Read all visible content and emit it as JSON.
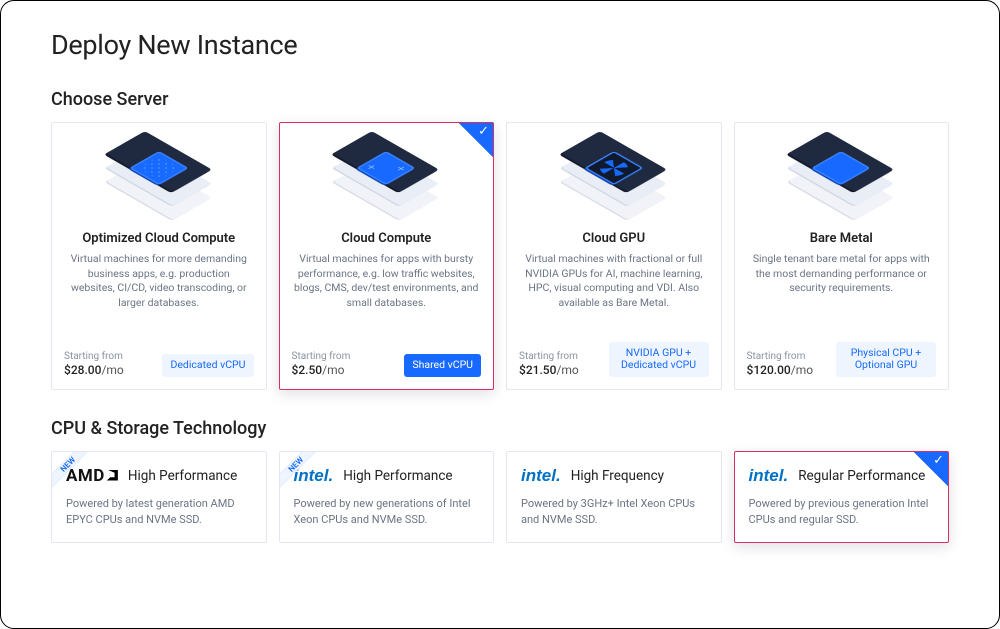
{
  "page": {
    "title": "Deploy New Instance"
  },
  "server_section": {
    "title": "Choose Server",
    "starting_label": "Starting from",
    "cards": [
      {
        "title": "Optimized Cloud Compute",
        "desc": "Virtual machines for more demanding business apps, e.g. production websites, CI/CD, video transcoding, or larger databases.",
        "price": "$28.00",
        "tag": "Dedicated vCPU",
        "tag_style": "light"
      },
      {
        "title": "Cloud Compute",
        "desc": "Virtual machines for apps with bursty performance, e.g. low traffic websites, blogs, CMS, dev/test environments, and small databases.",
        "price": "$2.50",
        "tag": "Shared vCPU",
        "tag_style": "solid",
        "selected": true
      },
      {
        "title": "Cloud GPU",
        "desc": "Virtual machines with fractional or full NVIDIA GPUs for AI, machine learning, HPC, visual computing and VDI. Also available as Bare Metal.",
        "price": "$21.50",
        "tag": "NVIDIA GPU + Dedicated vCPU",
        "tag_style": "light"
      },
      {
        "title": "Bare Metal",
        "desc": "Single tenant bare metal for apps with the most demanding performance or security requirements.",
        "price": "$120.00",
        "tag": "Physical CPU + Optional GPU",
        "tag_style": "light"
      }
    ]
  },
  "tech_section": {
    "title": "CPU & Storage Technology",
    "new_label": "NEW",
    "cards": [
      {
        "brand": "amd",
        "brand_text": "AMD",
        "title": "High Performance",
        "desc": "Powered by latest generation AMD EPYC CPUs and NVMe SSD.",
        "new": true
      },
      {
        "brand": "intel",
        "brand_text": "intel",
        "title": "High Performance",
        "desc": "Powered by new generations of Intel Xeon CPUs and NVMe SSD.",
        "new": true
      },
      {
        "brand": "intel",
        "brand_text": "intel",
        "title": "High Frequency",
        "desc": "Powered by 3GHz+ Intel Xeon CPUs and NVMe SSD."
      },
      {
        "brand": "intel",
        "brand_text": "intel",
        "title": "Regular Performance",
        "desc": "Powered by previous generation Intel CPUs and regular SSD.",
        "selected": true
      }
    ]
  }
}
